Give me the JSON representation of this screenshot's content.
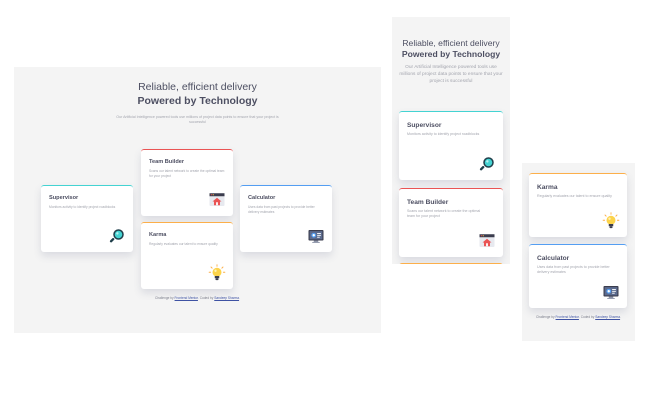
{
  "header": {
    "title_light": "Reliable, efficient delivery",
    "title_bold": "Powered by Technology",
    "description_desktop": "Our Artificial Intelligence powered tools use millions of project data points to ensure that your project is successful",
    "description_tablet": "Our Artificial Intelligence powered tools use millions of project data points to ensure that your project is successful"
  },
  "cards": {
    "supervisor": {
      "title": "Supervisor",
      "desc_desktop": "Monitors activity to identify project roadblocks",
      "desc_tablet": "Monitors activity to identify project roadblocks",
      "icon": "magnifier-icon"
    },
    "team_builder": {
      "title": "Team Builder",
      "desc_desktop": "Scans our talent network to create the optimal team for your project",
      "desc_tablet": "Scans our talent network to create the optimal team for your project",
      "icon": "team-builder-icon"
    },
    "karma": {
      "title": "Karma",
      "desc_desktop": "Regularly evaluates our talent to ensure quality",
      "desc_tablet": "Regularly evaluates our talent to ensure quality",
      "icon": "lightbulb-icon"
    },
    "calculator": {
      "title": "Calculator",
      "desc_desktop": "Uses data from past projects to provide better delivery estimates",
      "desc_tablet": "Uses data from past projects to provide better delivery estimates",
      "icon": "monitor-icon"
    }
  },
  "attribution": {
    "prefix": "Challenge by",
    "link1": "Frontend Mentor",
    "middle": ". Coded by",
    "link2": "Sandeep Sharma",
    "suffix": "."
  },
  "colors": {
    "cyan": "#44d3d2",
    "red": "#ea5454",
    "orange": "#fcaf4a",
    "blue": "#549ef2",
    "background": "#f4f4f4",
    "heading": "#4d4f62",
    "muted": "#a3a5ae"
  }
}
